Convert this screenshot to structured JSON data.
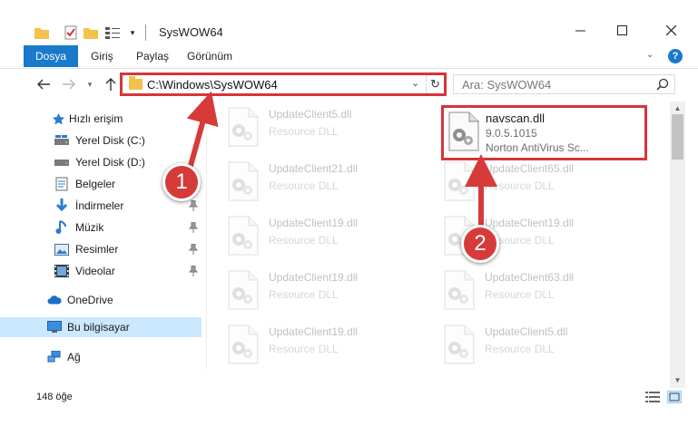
{
  "window": {
    "title": "SysWOW64",
    "controls": {
      "minimize": "minimize-icon",
      "maximize": "maximize-icon",
      "close": "close-icon"
    }
  },
  "ribbon": {
    "tabs": [
      "Dosya",
      "Giriş",
      "Paylaş",
      "Görünüm"
    ],
    "help": "?"
  },
  "address": {
    "path": "C:\\Windows\\SysWOW64",
    "search_placeholder": "Ara: SysWOW64"
  },
  "sidebar": {
    "items": [
      {
        "label": "Hızlı erişim",
        "icon": "star-icon"
      },
      {
        "label": "Yerel Disk (C:)",
        "icon": "drive-icon"
      },
      {
        "label": "Yerel Disk (D:)",
        "icon": "drive-icon"
      },
      {
        "label": "Belgeler",
        "icon": "documents-icon"
      },
      {
        "label": "İndirmeler",
        "icon": "download-icon"
      },
      {
        "label": "Müzik",
        "icon": "music-icon"
      },
      {
        "label": "Resimler",
        "icon": "pictures-icon"
      },
      {
        "label": "Videolar",
        "icon": "videos-icon"
      },
      {
        "label": "OneDrive",
        "icon": "cloud-icon"
      },
      {
        "label": "Bu bilgisayar",
        "icon": "computer-icon"
      },
      {
        "label": "Ağ",
        "icon": "network-icon"
      }
    ]
  },
  "files": {
    "left": [
      {
        "name": "UpdateClient5.dll",
        "type": "Resource DLL"
      },
      {
        "name": "UpdateClient21.dll",
        "type": "Resource DLL"
      },
      {
        "name": "UpdateClient19.dll",
        "type": "Resource DLL"
      },
      {
        "name": "UpdateClient19.dll",
        "type": "Resource DLL"
      },
      {
        "name": "UpdateClient19.dll",
        "type": "Resource DLL"
      }
    ],
    "right": [
      {
        "name": "navscan.dll",
        "version": "9.0.5.1015",
        "company": "Norton AntiVirus Sc..."
      },
      {
        "name": "UpdateClient65.dll",
        "type": "Resource DLL"
      },
      {
        "name": "UpdateClient19.dll",
        "type": "Resource DLL"
      },
      {
        "name": "UpdateClient63.dll",
        "type": "Resource DLL"
      },
      {
        "name": "UpdateClient5.dll",
        "type": "Resource DLL"
      }
    ]
  },
  "status": {
    "count": "148 öğe"
  },
  "callouts": [
    "1",
    "2"
  ],
  "colors": {
    "accent": "#1979ca",
    "highlight": "#d9343a",
    "selected": "#cce8ff"
  }
}
